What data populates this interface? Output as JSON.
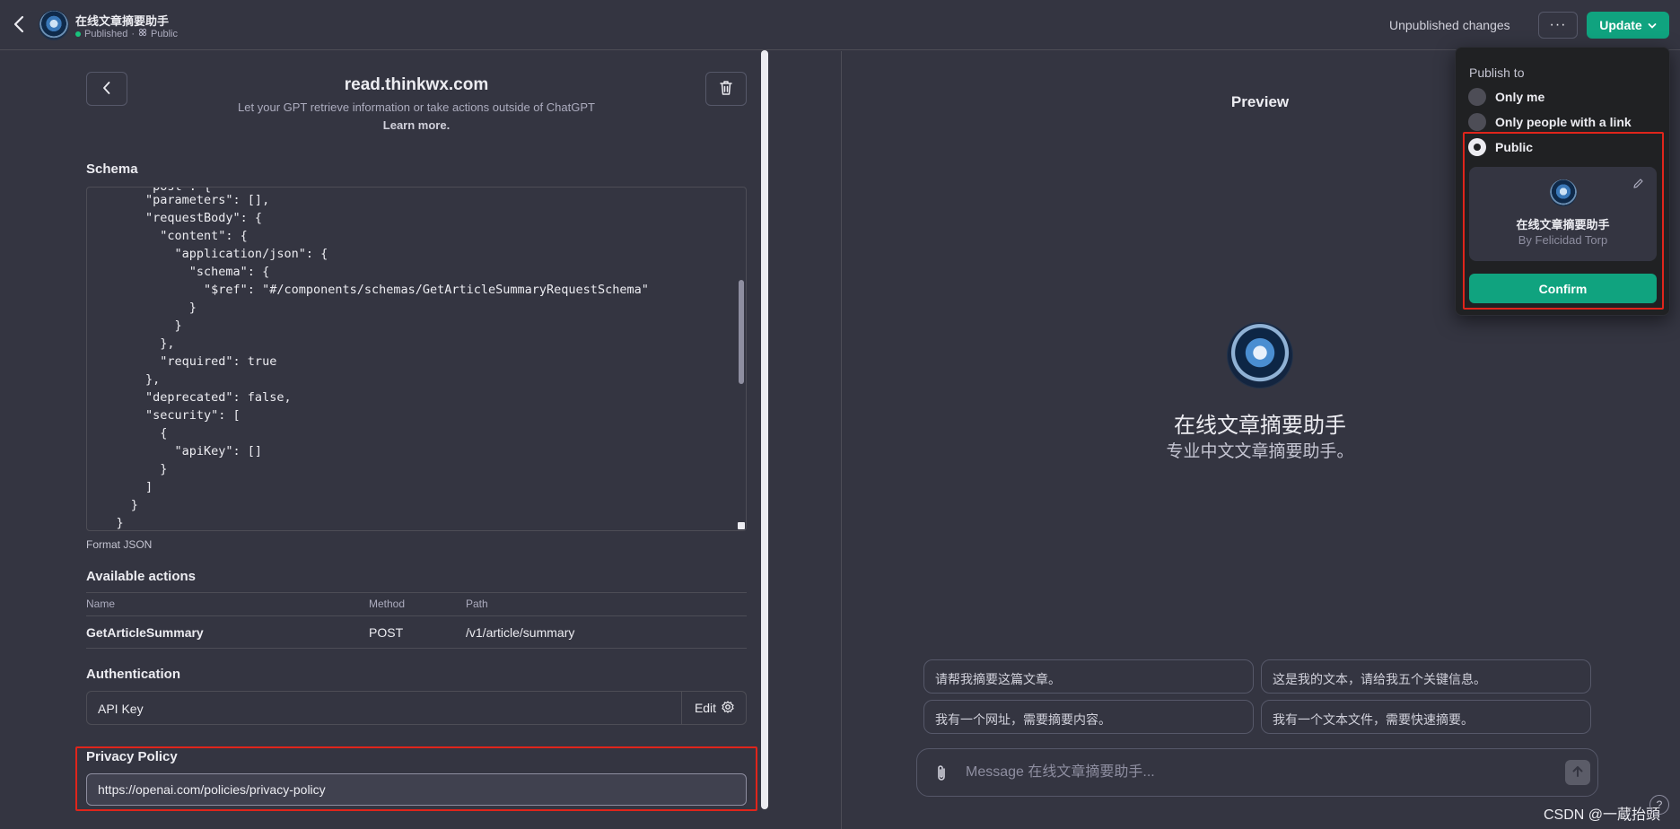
{
  "header": {
    "gpt_name": "在线文章摘要助手",
    "status_label": "Published",
    "status_sep": "·",
    "visibility_label": "Public",
    "unpublished": "Unpublished changes",
    "more_label": "···",
    "update_label": "Update"
  },
  "action_editor": {
    "domain": "read.thinkwx.com",
    "subtitle": "Let your GPT retrieve information or take actions outside of ChatGPT",
    "learn_more": "Learn more.",
    "schema_heading": "Schema",
    "schema_lines": [
      "        \"parameters\": [],",
      "        \"requestBody\": {",
      "          \"content\": {",
      "            \"application/json\": {",
      "              \"schema\": {",
      "                \"$ref\": \"#/components/schemas/GetArticleSummaryRequestSchema\"",
      "              }",
      "            }",
      "          },",
      "          \"required\": true",
      "        },",
      "        \"deprecated\": false,",
      "        \"security\": [",
      "          {",
      "            \"apiKey\": []",
      "          }",
      "        ]",
      "      }",
      "    }"
    ],
    "format_json": "Format JSON",
    "actions_heading": "Available actions",
    "actions_columns": [
      "Name",
      "Method",
      "Path"
    ],
    "actions_rows": [
      {
        "name": "GetArticleSummary",
        "method": "POST",
        "path": "/v1/article/summary"
      }
    ],
    "auth_heading": "Authentication",
    "auth_value": "API Key",
    "auth_edit": "Edit",
    "privacy_heading": "Privacy Policy",
    "privacy_url": "https://openai.com/policies/privacy-policy"
  },
  "preview": {
    "title": "Preview",
    "name": "在线文章摘要助手",
    "description": "专业中文文章摘要助手。",
    "suggestions": [
      "请帮我摘要这篇文章。",
      "这是我的文本，请给我五个关键信息。",
      "我有一个网址，需要摘要内容。",
      "我有一个文本文件，需要快速摘要。"
    ],
    "message_placeholder": "Message 在线文章摘要助手..."
  },
  "publish_popover": {
    "heading": "Publish to",
    "options": [
      {
        "label": "Only me",
        "selected": false
      },
      {
        "label": "Only people with a link",
        "selected": false
      },
      {
        "label": "Public",
        "selected": true
      }
    ],
    "card_name": "在线文章摘要助手",
    "card_by": "By Felicidad Torp",
    "confirm_label": "Confirm"
  },
  "watermark": "CSDN @一蔵抬頭",
  "help_label": "?",
  "colors": {
    "background": "#343541",
    "accent": "#10a37f",
    "highlight_frame": "#e0251b",
    "popover_bg": "#202123"
  }
}
